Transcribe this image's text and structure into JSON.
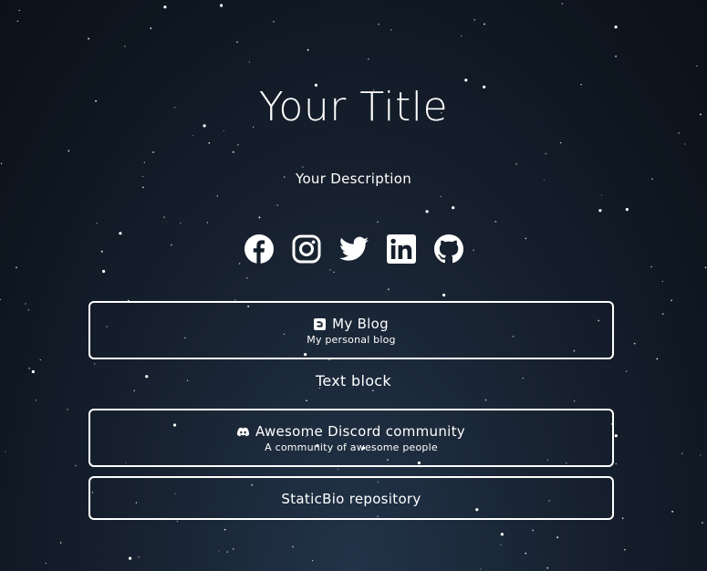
{
  "header": {
    "title": "Your Title",
    "description": "Your Description"
  },
  "socials": [
    {
      "name": "facebook",
      "icon": "facebook-icon"
    },
    {
      "name": "instagram",
      "icon": "instagram-icon"
    },
    {
      "name": "twitter",
      "icon": "twitter-icon"
    },
    {
      "name": "linkedin",
      "icon": "linkedin-icon"
    },
    {
      "name": "github",
      "icon": "github-icon"
    }
  ],
  "links": {
    "blog": {
      "title": "My Blog",
      "subtitle": "My personal blog",
      "icon": "blogger-icon"
    },
    "text_block": "Text block",
    "discord": {
      "title": "Awesome Discord community",
      "subtitle": "A community of awesome people",
      "icon": "discord-icon"
    },
    "repo": {
      "title": "StaticBio repository"
    }
  },
  "colors": {
    "background_center": "#223449",
    "background_edge": "#0b1119",
    "foreground": "#ffffff"
  }
}
